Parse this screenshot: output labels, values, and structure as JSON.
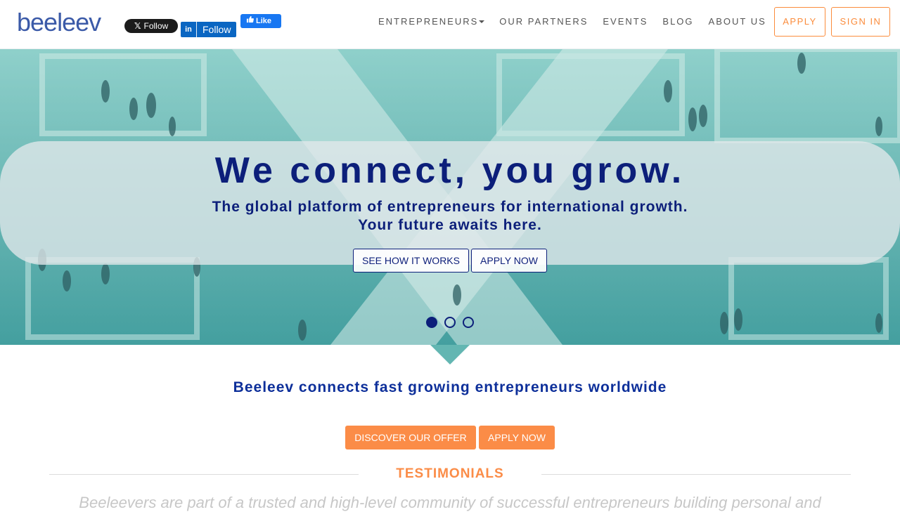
{
  "header": {
    "logo": "beeleev",
    "social": {
      "twitter_label": "Follow",
      "linkedin_logo": "in",
      "linkedin_label": "Follow",
      "facebook_label": "Like"
    },
    "nav": {
      "entrepreneurs": "ENTREPRENEURS",
      "partners": "OUR PARTNERS",
      "events": "EVENTS",
      "blog": "BLOG",
      "about": "ABOUT US"
    },
    "apply_label": "APPLY",
    "signin_label": "SIGN IN"
  },
  "hero": {
    "title": "We connect, you grow.",
    "subtitle_line1": "The global platform of entrepreneurs for international growth.",
    "subtitle_line2": "Your future awaits here.",
    "see_how_label": "SEE HOW IT WORKS",
    "apply_now_label": "APPLY NOW",
    "slides": 3,
    "active_slide": 1
  },
  "intro": {
    "headline": "Beeleev connects fast growing entrepreneurs worldwide",
    "discover_label": "DISCOVER OUR OFFER",
    "apply_now_label": "APPLY NOW"
  },
  "testimonials": {
    "title": "TESTIMONIALS",
    "text": "Beeleevers are part of a trusted and high-level community of successful entrepreneurs building personal and"
  },
  "colors": {
    "brand_blue": "#0c1f7a",
    "accent_orange": "#fb8c47",
    "logo_blue": "#3b5aa8"
  }
}
